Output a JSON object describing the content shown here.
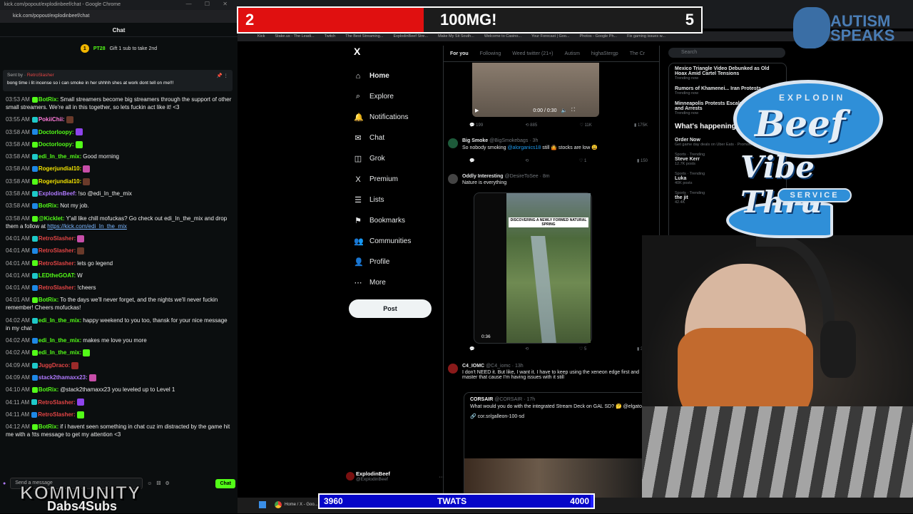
{
  "chat_window": {
    "title": "kick.com/popout/explodinbeef/chat - Google Chrome",
    "url": "kick.com/popout/explodinbeef/chat",
    "header": "Chat",
    "sub_banner": {
      "count": "1",
      "name": "PT28",
      "text": "Gift 1 sub to take 2nd"
    },
    "pinned": {
      "sent_by_label": "Sent by",
      "sent_by_user": "RetroSlasher",
      "text": "bong time i lit incense so i can smoke in her shhhh shes at work dont tell on me!!!"
    },
    "messages": [
      {
        "time": "03:53 AM",
        "user": "BotRix:",
        "color": "#53fc18",
        "text": "Small streamers become big streamers through the support of other small streamers. We're all in this together, so lets fuckin act like it! <3"
      },
      {
        "time": "03:55 AM",
        "user": "PokiiChii:",
        "color": "#ff7ad9",
        "text": ""
      },
      {
        "time": "03:58 AM",
        "user": "Doctorloopy:",
        "color": "#53fc18",
        "text": ""
      },
      {
        "time": "03:58 AM",
        "user": "Doctorloopy:",
        "color": "#53fc18",
        "text": ""
      },
      {
        "time": "03:58 AM",
        "user": "edi_In_the_mix:",
        "color": "#53fc18",
        "text": "Good morning"
      },
      {
        "time": "03:58 AM",
        "user": "Rogerjundial10:",
        "color": "#f2e300",
        "text": ""
      },
      {
        "time": "03:58 AM",
        "user": "Rogerjundial10:",
        "color": "#f2e300",
        "text": ""
      },
      {
        "time": "03:58 AM",
        "user": "ExplodinBeef:",
        "color": "#b07aff",
        "text": "!so @edi_In_the_mix"
      },
      {
        "time": "03:58 AM",
        "user": "BotRix:",
        "color": "#53fc18",
        "text": "Not my job."
      },
      {
        "time": "03:58 AM",
        "user": "@Kicklet:",
        "color": "#53fc18",
        "text": "Y'all like chill mofuckas? Go check out edi_In_the_mix and drop them a follow at",
        "link": "https://kick.com/edi_In_the_mix"
      },
      {
        "time": "04:01 AM",
        "user": "RetroSlasher:",
        "color": "#e34545",
        "text": ""
      },
      {
        "time": "04:01 AM",
        "user": "RetroSlasher:",
        "color": "#e34545",
        "text": ""
      },
      {
        "time": "04:01 AM",
        "user": "RetroSlasher:",
        "color": "#e34545",
        "text": "lets go legend"
      },
      {
        "time": "04:01 AM",
        "user": "LEDtheGOAT:",
        "color": "#53fc18",
        "text": "W"
      },
      {
        "time": "04:01 AM",
        "user": "RetroSlasher:",
        "color": "#e34545",
        "text": "!cheers"
      },
      {
        "time": "04:01 AM",
        "user": "BotRix:",
        "color": "#53fc18",
        "text": "To the days we'll never forget, and the nights we'll never fuckin remember! Cheers mofuckas!"
      },
      {
        "time": "04:02 AM",
        "user": "edi_In_the_mix:",
        "color": "#53fc18",
        "text": "happy weekend to you too, thansk for your nice message in my chat"
      },
      {
        "time": "04:02 AM",
        "user": "edi_In_the_mix:",
        "color": "#53fc18",
        "text": "makes me love you more"
      },
      {
        "time": "04:02 AM",
        "user": "edi_In_the_mix:",
        "color": "#53fc18",
        "text": ""
      },
      {
        "time": "04:09 AM",
        "user": "JuggDraco:",
        "color": "#e34545",
        "text": ""
      },
      {
        "time": "04:09 AM",
        "user": "stack2thamaxx23:",
        "color": "#b07aff",
        "text": ""
      },
      {
        "time": "04:10 AM",
        "user": "BotRix:",
        "color": "#53fc18",
        "text": "@stack2thamaxx23 you leveled up to Level 1"
      },
      {
        "time": "04:11 AM",
        "user": "RetroSlasher:",
        "color": "#e34545",
        "text": ""
      },
      {
        "time": "04:11 AM",
        "user": "RetroSlasher:",
        "color": "#e34545",
        "text": ""
      },
      {
        "time": "04:12 AM",
        "user": "BotRix:",
        "color": "#53fc18",
        "text": "if i havent seen something in chat cuz im distracted by the game hit me with a !tts message to get my attention <3"
      }
    ],
    "input_placeholder": "Send a message",
    "chat_button": "Chat"
  },
  "overlays": {
    "kommunity": "KOMMUNITY",
    "dabs": "Dabs4Subs",
    "goal_top": {
      "left": "2",
      "center": "100MG!",
      "right": "5",
      "progress": 0.4
    },
    "goal_bottom": {
      "left": "3960",
      "center": "TWATS",
      "right": "4000",
      "progress": 0.99
    },
    "autism_logo": "AUTISM SPEAKS",
    "beef_logo": {
      "top": "EXPLODIN",
      "main": "Beef",
      "vibe": "Vibe Thru",
      "service": "SERVICE"
    }
  },
  "browser": {
    "bookmarks": [
      "Kick",
      "Stake.us - The Leadi...",
      "Twitch",
      "The Best Streaming...",
      "ExplodinBeef Stre...",
      "Make My Sit South...",
      "Welcome to Casino...",
      "Your Forecast | Goo...",
      "Photos - Google Ph...",
      "Fix gaming issues w..."
    ],
    "x_nav": {
      "logo": "X",
      "items": [
        {
          "icon": "⌂",
          "label": "Home",
          "name": "home"
        },
        {
          "icon": "⌕",
          "label": "Explore",
          "name": "explore"
        },
        {
          "icon": "🔔",
          "label": "Notifications",
          "name": "notifications"
        },
        {
          "icon": "✉",
          "label": "Chat",
          "name": "chat"
        },
        {
          "icon": "◫",
          "label": "Grok",
          "name": "grok"
        },
        {
          "icon": "X",
          "label": "Premium",
          "name": "premium"
        },
        {
          "icon": "☰",
          "label": "Lists",
          "name": "lists"
        },
        {
          "icon": "⚑",
          "label": "Bookmarks",
          "name": "bookmarks"
        },
        {
          "icon": "👥",
          "label": "Communities",
          "name": "communities"
        },
        {
          "icon": "👤",
          "label": "Profile",
          "name": "profile"
        },
        {
          "icon": "⋯",
          "label": "More",
          "name": "more"
        }
      ],
      "post": "Post",
      "account_name": "ExplodinBeef",
      "account_handle": "@ExplodinBeef"
    },
    "feed": {
      "tabs": [
        "For you",
        "Following",
        "Weed twitter (21+)",
        "Autism",
        "highaStergp",
        "The Cr"
      ],
      "video_time": "0:00 / 0:30",
      "actions1": [
        "199",
        "885",
        "11K",
        "175K"
      ],
      "tweet1": {
        "name": "Big Smoke",
        "handle": "@BigSmokebags · 3h",
        "text_pre": "So nobody smoking ",
        "mention": "@alorganics18",
        "text_post": " still 🤷 stocks are low 😩"
      },
      "actions2": [
        "",
        "",
        "1",
        "150"
      ],
      "tweet2": {
        "name": "Oddly Interesting",
        "handle": "@DesireToSee · 8m",
        "text": "Nature is everything"
      },
      "nature_caption": "DISCOVERING A NEWLY FORMED NATURAL SPRING",
      "nature_duration": "0:36",
      "actions3": [
        "",
        "",
        "5",
        "328"
      ],
      "tweet3": {
        "name": "C4_IOMC",
        "handle": "@C4_iomc · 13h",
        "text": "I don't NEED it. But like, I want it. I have to keep using the xeneon edge first and master that cause I'm having issues with it still"
      },
      "quote": {
        "name": "CORSAIR",
        "handle": "@CORSAIR · 17h",
        "text": "What would you do with the integrated Stream Deck on GAL SD? 🤔 @elgato",
        "link": "cor.sr/galleon-100-sd"
      }
    },
    "sidebar": {
      "search_placeholder": "Search",
      "trends_top": [
        {
          "title": "Mexico Triangle Video Debunked as Old Hoax Amid Cartel Tensions",
          "sub": "Trending now"
        },
        {
          "title": "Rumors of Khamenei... Iran Protests",
          "sub": "Trending now"
        },
        {
          "title": "Minneapolis Protests Escalate... Shooting and Arrests",
          "sub": "Trending now"
        }
      ],
      "whats_happening": "What's happening",
      "trends": [
        {
          "title": "Order Now",
          "sub": "Get game day deals on Uber Eats · Promoted by Uber Eats"
        },
        {
          "cat": "Sports · Trending",
          "title": "Steve Kerr",
          "sub": "12.7K posts"
        },
        {
          "cat": "Sports · Trending",
          "title": "Luka",
          "sub": "40K posts"
        },
        {
          "cat": "Sports · Trending",
          "title": "the jit",
          "sub": "42.4K"
        }
      ]
    }
  },
  "taskbar": {
    "chrome_label": "Home / X - Goo..."
  },
  "colors": {
    "kick_green": "#53fc18",
    "x_blue": "#1d9bf0",
    "goal_red": "#e01010",
    "goal_blue": "#2020ff"
  }
}
